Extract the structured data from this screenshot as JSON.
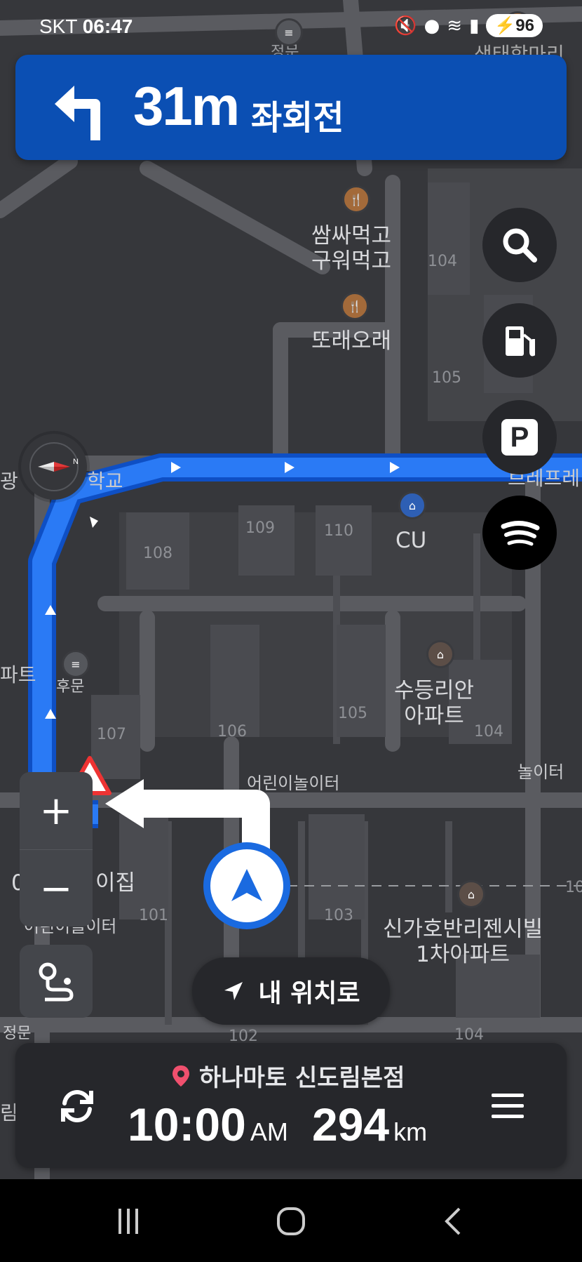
{
  "status_bar": {
    "carrier": "SKT",
    "time": "06:47",
    "battery": "96"
  },
  "nav_banner": {
    "distance": "31m",
    "instruction": "좌회전",
    "turn_icon": "turn-left-icon"
  },
  "map": {
    "labels": {
      "top_center": "정문",
      "top_right": "생태학마리",
      "kid_playground_1": "어린이놀이터",
      "restaurant_1": "쌈싸먹고\n구워먹고",
      "restaurant_2": "또래오래",
      "num_104a": "104",
      "kid_playground_2": "어린이놀이터",
      "num_105a": "105",
      "num_102": "102",
      "left_school_a": "광",
      "left_school_b": "학교",
      "right_store": "브레프레",
      "num_109": "109",
      "num_110": "110",
      "cu": "CU",
      "num_108": "108",
      "left_part": "파트",
      "rear_gate": "후문",
      "apt_sudeung": "수등리안\n아파트",
      "num_105b": "105",
      "num_104b": "104",
      "num_107": "107",
      "num_106": "106",
      "playground_3": "어린이놀이터",
      "playground_4": "놀이터",
      "left_house": "0",
      "house_name": "이집",
      "playground_5": "어린이놀이터",
      "num_101": "101",
      "num_103": "103",
      "apt_singaho": "신가호반리젠시빌\n1차아파트",
      "right_10": "10",
      "left_gate": "정문",
      "num_102b": "102",
      "num_104c": "104",
      "left_rim": "림"
    }
  },
  "buttons": {
    "search": "search-icon",
    "gas": "gas-station-icon",
    "parking": "P",
    "spotify": "spotify-icon",
    "zoom_in": "+",
    "zoom_out": "−",
    "my_location": "내 위치로"
  },
  "bottom_card": {
    "destination": "하나마토 신도림본점",
    "eta_time": "10:00",
    "eta_ampm": "AM",
    "distance_value": "294",
    "distance_unit": "km"
  },
  "colors": {
    "route": "#1f6ff0",
    "banner": "#0b4fb3",
    "map_bg": "#3a3b3f"
  }
}
